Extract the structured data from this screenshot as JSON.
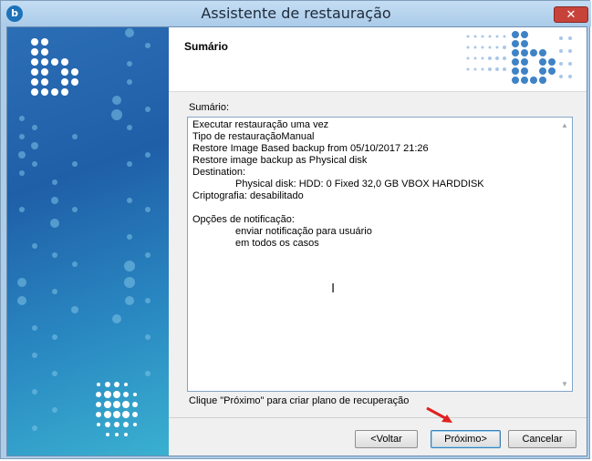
{
  "window": {
    "title": "Assistente de restauração",
    "close_glyph": "✕",
    "app_icon_glyph": "b"
  },
  "header": {
    "title": "Sumário"
  },
  "summary": {
    "label": "Sumário:",
    "lines": [
      "Executar restauração uma vez",
      "Tipo de restauraçãoManual",
      "Restore Image Based backup from 05/10/2017 21:26",
      "Restore image backup as Physical disk",
      "Destination:",
      "Physical disk: HDD: 0 Fixed 32,0 GB VBOX HARDDISK",
      "Criptografia: desabilitado",
      "",
      "Opções de notificação:",
      "enviar notificação para usuário",
      "em todos os casos"
    ]
  },
  "hint": "Clique \"Próximo\" para criar plano de recuperação",
  "buttons": {
    "back": "<Voltar",
    "next": "Próximo>",
    "cancel": "Cancelar"
  },
  "colors": {
    "sidebar_blue": "#2c6eb5",
    "annotation_arrow": "#e02020",
    "close_red": "#c7433a"
  }
}
